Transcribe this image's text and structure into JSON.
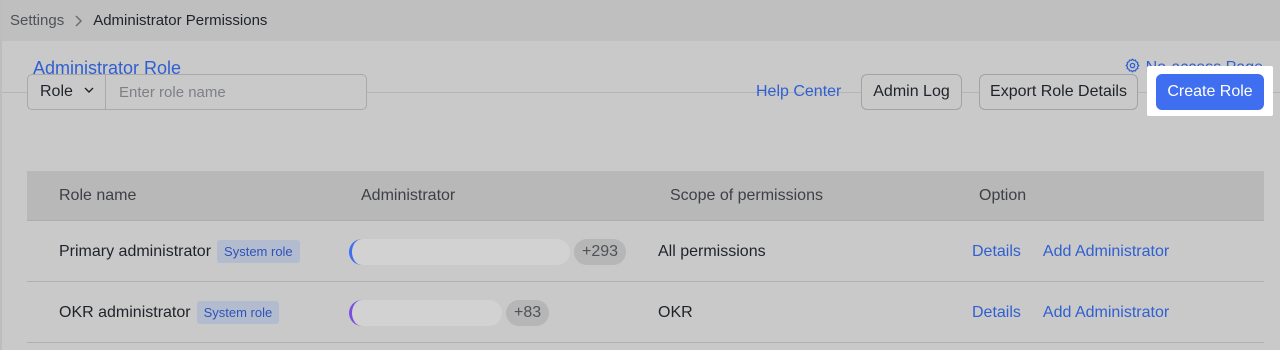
{
  "breadcrumb": {
    "parent": "Settings",
    "current": "Administrator Permissions"
  },
  "tabs": {
    "active": "Administrator Role",
    "no_access_link": "No-access Page"
  },
  "toolbar": {
    "role_select_value": "Role",
    "role_input_placeholder": "Enter role name",
    "help_center": "Help Center",
    "admin_log": "Admin Log",
    "export_role_details": "Export Role Details",
    "create_role": "Create Role"
  },
  "table": {
    "headers": [
      "Role name",
      "Administrator",
      "Scope of permissions",
      "Option"
    ],
    "rows": [
      {
        "role_name": "Primary administrator",
        "badge": "System role",
        "admin_count": "+293",
        "scope": "All permissions",
        "options": [
          "Details",
          "Add Administrator"
        ]
      },
      {
        "role_name": "OKR administrator",
        "badge": "System role",
        "admin_count": "+83",
        "scope": "OKR",
        "options": [
          "Details",
          "Add Administrator"
        ]
      }
    ]
  },
  "colors": {
    "accent": "#3f6ef0",
    "link": "#2f5fd0"
  },
  "icons": {
    "breadcrumb_separator": "chevron-right-icon",
    "no_access": "gear-icon",
    "role_select": "chevron-down-icon"
  }
}
